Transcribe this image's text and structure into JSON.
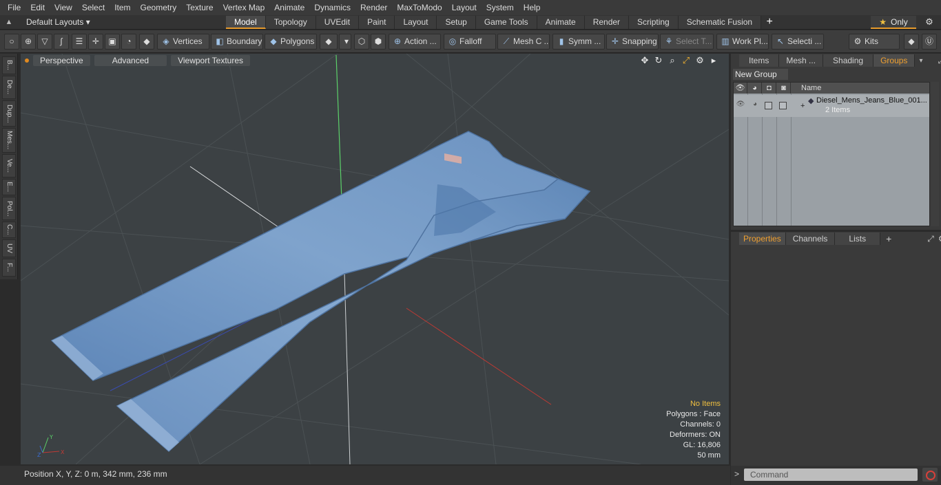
{
  "menu": [
    "File",
    "Edit",
    "View",
    "Select",
    "Item",
    "Geometry",
    "Texture",
    "Vertex Map",
    "Animate",
    "Dynamics",
    "Render",
    "MaxToModo",
    "Layout",
    "System",
    "Help"
  ],
  "layouts": {
    "label": "Default Layouts ▾"
  },
  "layout_tabs": [
    "Model",
    "Topology",
    "UVEdit",
    "Paint",
    "Layout",
    "Setup",
    "Game Tools",
    "Animate",
    "Render",
    "Scripting",
    "Schematic Fusion"
  ],
  "active_tab": "Model",
  "only_label": "Only",
  "toolbar": {
    "vertices": "Vertices",
    "boundary": "Boundary",
    "polygons": "Polygons",
    "action": "Action ...",
    "falloff": "Falloff",
    "mesh": "Mesh C ...",
    "symm": "Symm ...",
    "snapping": "Snapping",
    "select_t": "Select T...",
    "work_pl": "Work Pl...",
    "selecti": "Selecti ...",
    "kits": "Kits"
  },
  "left_tabs": [
    "B...",
    "De...",
    "Dup...",
    "Mes...",
    "Ve...",
    "E...",
    "Pol...",
    "C...",
    "UV",
    "F..."
  ],
  "viewport": {
    "perspective": "Perspective",
    "advanced": "Advanced",
    "textures": "Viewport Textures",
    "info": {
      "no_items": "No Items",
      "polygons": "Polygons : Face",
      "channels": "Channels: 0",
      "deformers": "Deformers: ON",
      "gl": "GL: 16,806",
      "scale": "50 mm"
    },
    "axes": {
      "y": "Y",
      "x": "X",
      "z": "Z"
    }
  },
  "status": {
    "position": "Position X, Y, Z:   0 m, 342 mm, 236 mm"
  },
  "right_panel": {
    "tabs": [
      "Items",
      "Mesh ...",
      "Shading",
      "Groups"
    ],
    "active_tab": "Groups",
    "new_group": "New Group",
    "name_header": "Name",
    "group": {
      "name": "Diesel_Mens_Jeans_Blue_001...",
      "count": "2 Items"
    },
    "bottom_tabs": [
      "Properties",
      "Channels",
      "Lists"
    ],
    "bottom_active": "Properties"
  },
  "command": {
    "placeholder": "Command"
  },
  "colors": {
    "accent": "#e89b2a",
    "denim": "#6d93c2",
    "viewport_bg": "#3c4144"
  }
}
